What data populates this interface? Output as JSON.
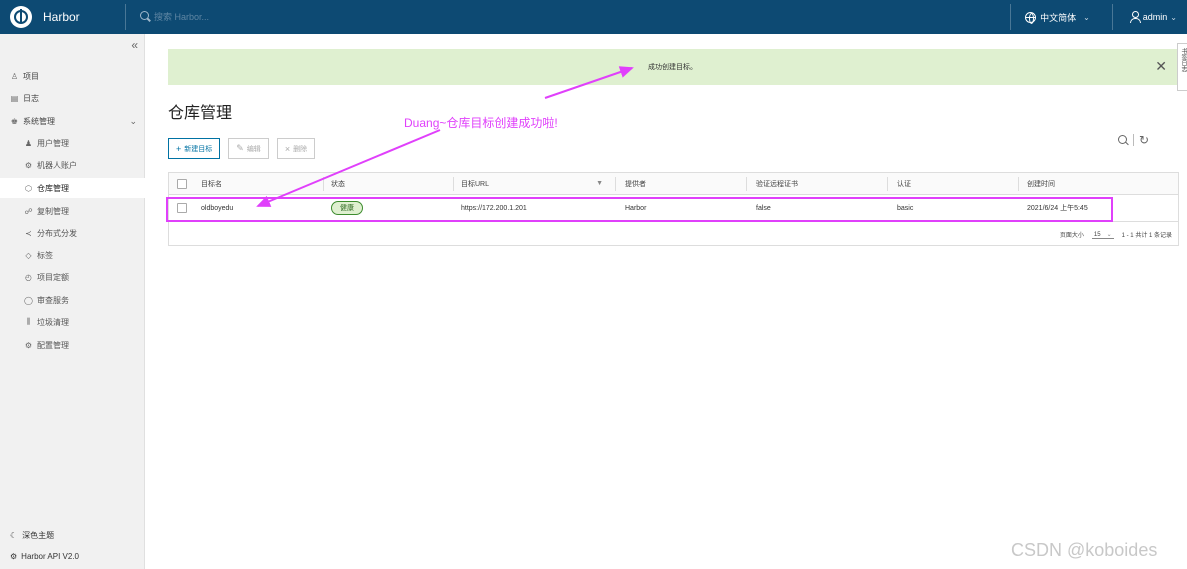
{
  "header": {
    "brand": "Harbor",
    "search_placeholder": "搜索 Harbor...",
    "language": "中文简体",
    "user": "admin"
  },
  "sidebar": {
    "items": [
      {
        "label": "项目",
        "icon": "project-icon"
      },
      {
        "label": "日志",
        "icon": "log-icon"
      },
      {
        "label": "系统管理",
        "icon": "admin-icon"
      },
      {
        "label": "用户管理",
        "icon": "users-icon"
      },
      {
        "label": "机器人账户",
        "icon": "robot-icon"
      },
      {
        "label": "仓库管理",
        "icon": "registry-icon"
      },
      {
        "label": "复制管理",
        "icon": "replication-icon"
      },
      {
        "label": "分布式分发",
        "icon": "distribution-icon"
      },
      {
        "label": "标签",
        "icon": "tag-icon"
      },
      {
        "label": "项目定额",
        "icon": "quota-icon"
      },
      {
        "label": "审查服务",
        "icon": "shield-icon"
      },
      {
        "label": "垃圾清理",
        "icon": "trash-icon"
      },
      {
        "label": "配置管理",
        "icon": "gear-icon"
      }
    ],
    "theme": "深色主题",
    "api": "Harbor API V2.0"
  },
  "alert": {
    "message": "成功创建目标。"
  },
  "side_tab": "书签日志",
  "page": {
    "title": "仓库管理"
  },
  "annotation": "Duang~仓库目标创建成功啦!",
  "toolbar": {
    "new": "新建目标",
    "edit": "编辑",
    "delete": "删除"
  },
  "table": {
    "headers": [
      "目标名",
      "状态",
      "目标URL",
      "提供者",
      "验证远程证书",
      "认证",
      "创建时间"
    ],
    "rows": [
      {
        "name": "oldboyedu",
        "status": "健康",
        "url": "https://172.200.1.201",
        "provider": "Harbor",
        "verify": "false",
        "auth": "basic",
        "created": "2021/6/24 上午5:45"
      }
    ],
    "footer": {
      "page_size_label": "页面大小",
      "page_size": "15",
      "summary": "1 - 1 共计 1 条记录"
    }
  },
  "watermark": "CSDN @koboides",
  "colors": {
    "header": "#0d4a73",
    "accent": "#e040fb",
    "success_bg": "#dff0d0"
  }
}
